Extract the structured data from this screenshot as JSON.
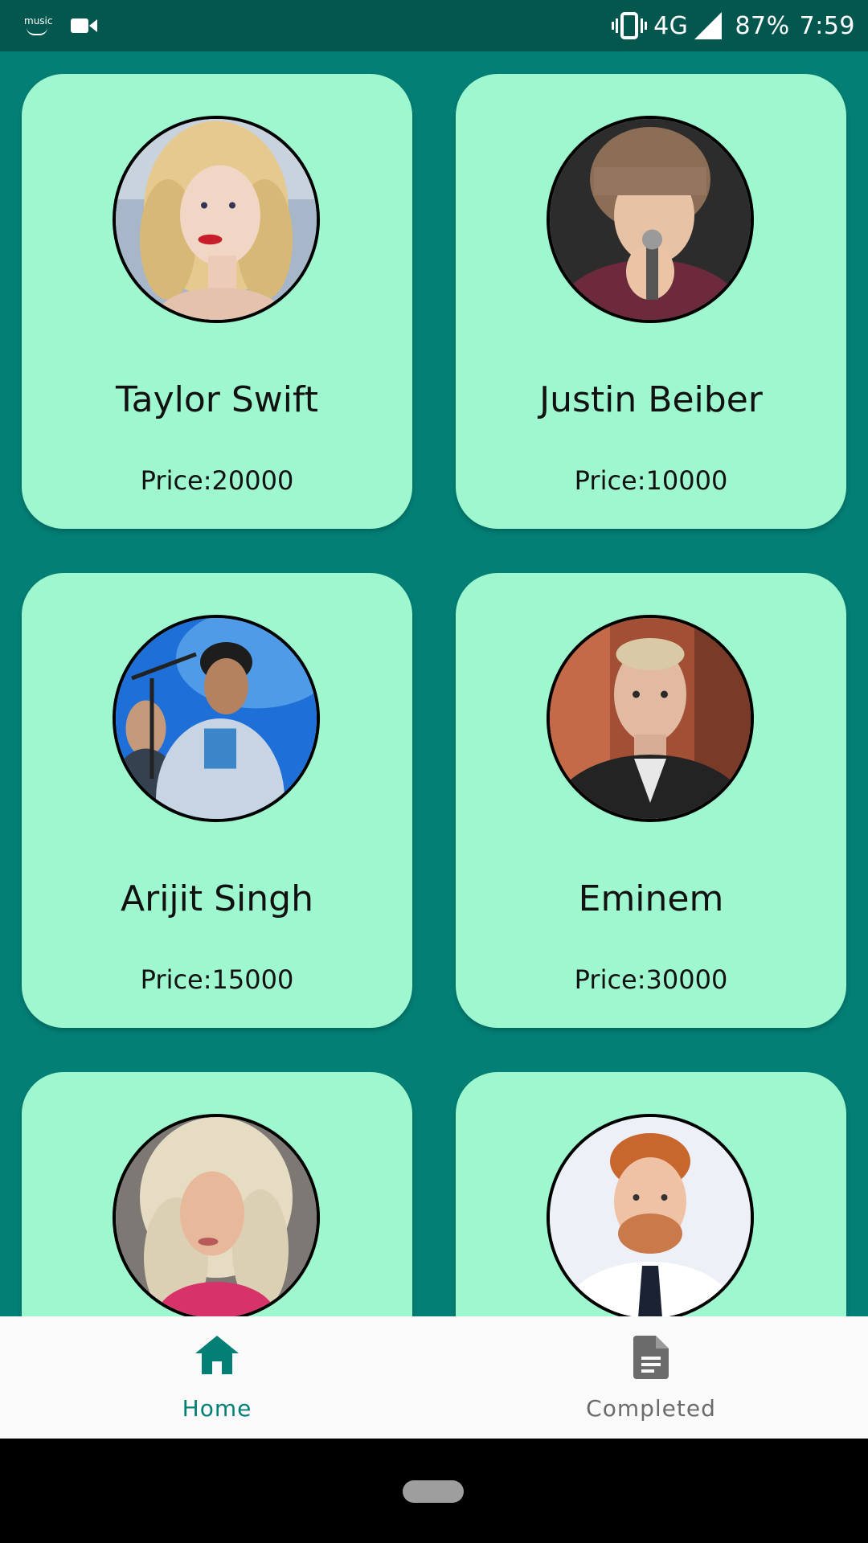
{
  "status_bar": {
    "left_icons": [
      "amazon-music-icon",
      "video-camera-icon"
    ],
    "music_label": "music",
    "network": "4G",
    "battery": "87%",
    "time": "7:59"
  },
  "artists": [
    {
      "name": "Taylor Swift",
      "price": "Price:20000",
      "photo": "taylor-swift-photo"
    },
    {
      "name": "Justin Beiber",
      "price": "Price:10000",
      "photo": "justin-beiber-photo"
    },
    {
      "name": "Arijit Singh",
      "price": "Price:15000",
      "photo": "arijit-singh-photo"
    },
    {
      "name": "Eminem",
      "price": "Price:30000",
      "photo": "eminem-photo"
    },
    {
      "name": "",
      "price": "",
      "photo": "blonde-singer-photo"
    },
    {
      "name": "",
      "price": "",
      "photo": "ed-sheeran-photo"
    }
  ],
  "bottom_nav": {
    "items": [
      {
        "label": "Home",
        "icon": "home-icon",
        "selected": true
      },
      {
        "label": "Completed",
        "icon": "document-icon",
        "selected": false
      }
    ]
  },
  "colors": {
    "background": "#037f75",
    "status_bar": "#03574f",
    "card": "#9ff7cf",
    "accent": "#037f75",
    "inactive": "#6b6b6b"
  }
}
